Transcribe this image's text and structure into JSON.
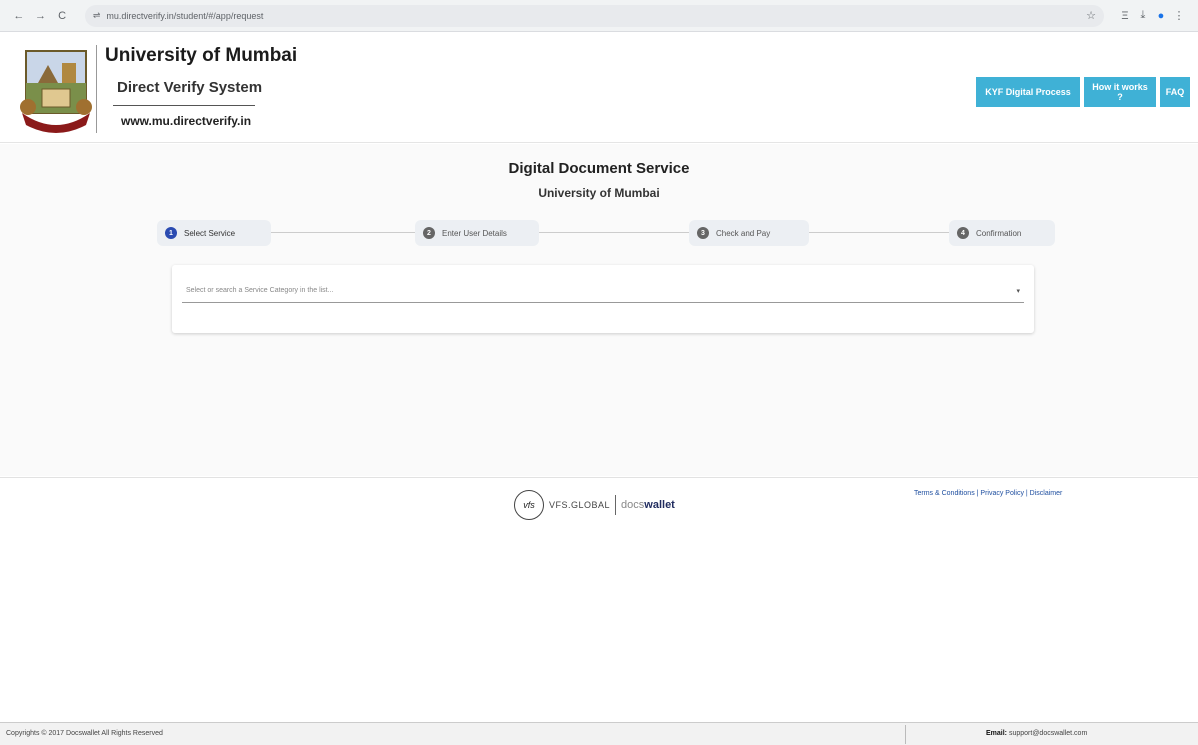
{
  "browser": {
    "back": "←",
    "forward": "→",
    "reload": "C",
    "url": "mu.directverify.in/student/#/app/request",
    "star": "☆",
    "tools": [
      "Ξ",
      "⤓",
      "●",
      "⋮"
    ]
  },
  "header": {
    "university_name": "University of Mumbai",
    "system_name": "Direct Verify System",
    "website": "www.mu.directverify.in",
    "buttons": [
      "KYF Digital Process",
      "How it works ?",
      "FAQ"
    ]
  },
  "main": {
    "title": "Digital Document Service",
    "subtitle": "University of Mumbai",
    "steps": [
      {
        "number": "1",
        "label": "Select Service"
      },
      {
        "number": "2",
        "label": "Enter User Details"
      },
      {
        "number": "3",
        "label": "Check and Pay"
      },
      {
        "number": "4",
        "label": "Confirmation"
      }
    ],
    "select_placeholder": "Select or search a Service Category in the list...",
    "select_caret": "▾"
  },
  "footer": {
    "vfs_badge": "vfs",
    "vfs_name": "VFS.GLOBAL",
    "docs": "docs",
    "wallet": "wallet",
    "links": "Terms & Conditions | Privacy Policy | Disclaimer",
    "copyright": "Copyrights © 2017 Docswallet All Rights Reserved",
    "email_label": "Email:",
    "email_value": "support@docswallet.com"
  },
  "colors": {
    "accent": "#3fb1d6",
    "step_active": "#2b4bb1"
  }
}
